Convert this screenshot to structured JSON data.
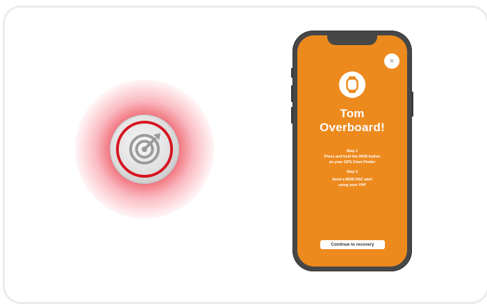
{
  "beacon": {
    "icon": "radar-icon",
    "glow_color": "#e81c2c",
    "ring_color": "#d7141f"
  },
  "phone": {
    "screen_color": "#ed8a1e",
    "close_label": "×",
    "icon": "smartwatch-icon",
    "title_line1": "Tom",
    "title_line2": "Overboard!",
    "step1_heading": "Step 1",
    "step1_line1": "Press and hold the MOB button",
    "step1_line2": "on your GPS Chart Plotter",
    "step2_heading": "Step 2",
    "step2_line1": "Send a MOB DSC alert",
    "step2_line2": "using your VHF",
    "cta_label": "Continue to recovery"
  }
}
